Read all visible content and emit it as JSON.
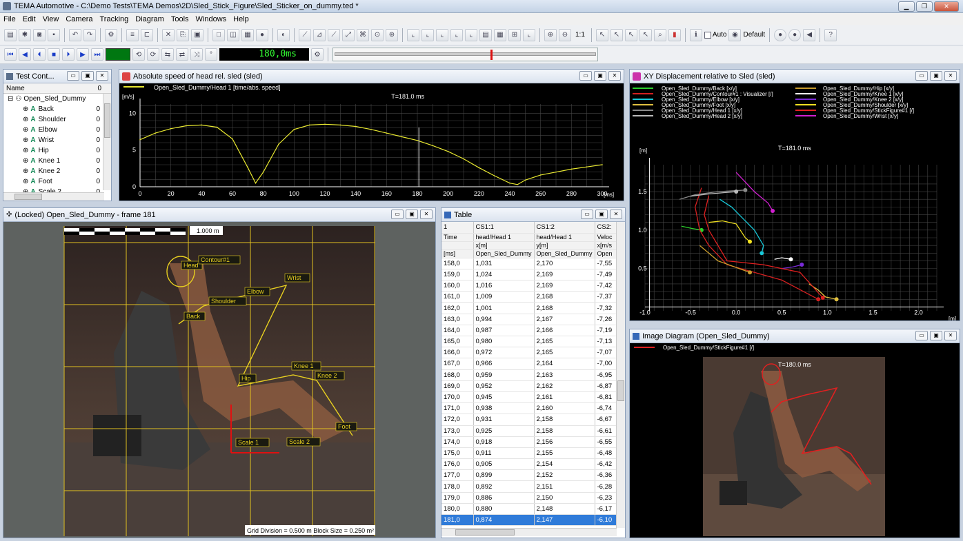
{
  "app": {
    "title": "TEMA Automotive - C:\\Demo Tests\\TEMA Demos\\2D\\Sled_Stick_Figure\\Sled_Sticker_on_dummy.ted *"
  },
  "menu": [
    "File",
    "Edit",
    "View",
    "Camera",
    "Tracking",
    "Diagram",
    "Tools",
    "Windows",
    "Help"
  ],
  "toolbar": {
    "scale_label": "1:1",
    "auto_label": "Auto",
    "default_label": "Default",
    "time_display": "180,0ms"
  },
  "panes": {
    "test_control": {
      "title": "Test Cont...",
      "col_name": "Name",
      "col_val": "0",
      "root": "Open_Sled_Dummy",
      "items": [
        {
          "label": "Back",
          "val": "0"
        },
        {
          "label": "Shoulder",
          "val": "0"
        },
        {
          "label": "Elbow",
          "val": "0"
        },
        {
          "label": "Wrist",
          "val": "0"
        },
        {
          "label": "Hip",
          "val": "0"
        },
        {
          "label": "Knee 1",
          "val": "0"
        },
        {
          "label": "Knee 2",
          "val": "0"
        },
        {
          "label": "Foot",
          "val": "0"
        },
        {
          "label": "Scale 2",
          "val": "0"
        }
      ]
    },
    "speed": {
      "title": "Absolute speed of head rel. sled (sled)",
      "legend": "Open_Sled_Dummy/Head 1 [time/abs. speed]",
      "unit_y": "[m/s]",
      "unit_x": "[ms]",
      "marker": "T=181.0 ms"
    },
    "xy": {
      "title": "XY Displacement relative to Sled (sled)",
      "unit_y": "[m]",
      "unit_x": "[m]",
      "marker": "T=181.0 ms",
      "legend_left": [
        {
          "label": "Open_Sled_Dummy/Back [x/y]",
          "color": "#2bd12b"
        },
        {
          "label": "Open_Sled_Dummy/Contour#1 : Visualizer [/]",
          "color": "#d42020"
        },
        {
          "label": "Open_Sled_Dummy/Elbow [x/y]",
          "color": "#18c8d8"
        },
        {
          "label": "Open_Sled_Dummy/Foot [x/y]",
          "color": "#e0c040"
        },
        {
          "label": "Open_Sled_Dummy/Head 1 [x/y]",
          "color": "#8a8a8a"
        },
        {
          "label": "Open_Sled_Dummy/Head 2 [x/y]",
          "color": "#bbbbbb"
        }
      ],
      "legend_right": [
        {
          "label": "Open_Sled_Dummy/Hip [x/y]",
          "color": "#c89b2b"
        },
        {
          "label": "Open_Sled_Dummy/Knee 1 [x/y]",
          "color": "#ffffff"
        },
        {
          "label": "Open_Sled_Dummy/Knee 2 [x/y]",
          "color": "#7a2bd8"
        },
        {
          "label": "Open_Sled_Dummy/Shoulder [x/y]",
          "color": "#f0e020"
        },
        {
          "label": "Open_Sled_Dummy/StickFigure#1 [/]",
          "color": "#e02020"
        },
        {
          "label": "Open_Sled_Dummy/Wrist [x/y]",
          "color": "#d020d0"
        }
      ]
    },
    "video": {
      "title": "(Locked) Open_Sled_Dummy - frame 181",
      "scale_label": "1.000 m",
      "grid_info": "Grid Division = 0.500 m  Block Size = 0.250 m²",
      "labels": [
        "Head",
        "Contour#1",
        "Wrist",
        "Shoulder",
        "Elbow",
        "Back",
        "Hip",
        "Knee 1",
        "Knee 2",
        "Foot",
        "Scale 1",
        "Scale 2"
      ]
    },
    "table": {
      "title": "Table",
      "cols": [
        "1",
        "CS1:1",
        "CS1:2",
        "CS2:"
      ],
      "hdr": [
        [
          "Time",
          "head/Head 1",
          "head/Head 1",
          "Veloc"
        ],
        [
          "",
          "x[m]",
          "y[m]",
          "x[m/s"
        ],
        [
          "[ms]",
          "Open_Sled_Dummy",
          "Open_Sled_Dummy",
          "Open"
        ]
      ],
      "rows": [
        [
          "158,0",
          "1,031",
          "2,170",
          "-7,55"
        ],
        [
          "159,0",
          "1,024",
          "2,169",
          "-7,49"
        ],
        [
          "160,0",
          "1,016",
          "2,169",
          "-7,42"
        ],
        [
          "161,0",
          "1,009",
          "2,168",
          "-7,37"
        ],
        [
          "162,0",
          "1,001",
          "2,168",
          "-7,32"
        ],
        [
          "163,0",
          "0,994",
          "2,167",
          "-7,26"
        ],
        [
          "164,0",
          "0,987",
          "2,166",
          "-7,19"
        ],
        [
          "165,0",
          "0,980",
          "2,165",
          "-7,13"
        ],
        [
          "166,0",
          "0,972",
          "2,165",
          "-7,07"
        ],
        [
          "167,0",
          "0,966",
          "2,164",
          "-7,00"
        ],
        [
          "168,0",
          "0,959",
          "2,163",
          "-6,95"
        ],
        [
          "169,0",
          "0,952",
          "2,162",
          "-6,87"
        ],
        [
          "170,0",
          "0,945",
          "2,161",
          "-6,81"
        ],
        [
          "171,0",
          "0,938",
          "2,160",
          "-6,74"
        ],
        [
          "172,0",
          "0,931",
          "2,158",
          "-6,67"
        ],
        [
          "173,0",
          "0,925",
          "2,158",
          "-6,61"
        ],
        [
          "174,0",
          "0,918",
          "2,156",
          "-6,55"
        ],
        [
          "175,0",
          "0,911",
          "2,155",
          "-6,48"
        ],
        [
          "176,0",
          "0,905",
          "2,154",
          "-6,42"
        ],
        [
          "177,0",
          "0,899",
          "2,152",
          "-6,36"
        ],
        [
          "178,0",
          "0,892",
          "2,151",
          "-6,28"
        ],
        [
          "179,0",
          "0,886",
          "2,150",
          "-6,23"
        ],
        [
          "180,0",
          "0,880",
          "2,148",
          "-6,17"
        ],
        [
          "181,0",
          "0,874",
          "2,147",
          "-6,10"
        ]
      ],
      "selected_index": 23
    },
    "image": {
      "title": "Image Diagram (Open_Sled_Dummy)",
      "legend": "Open_Sled_Dummy/StickFigure#1 [/]",
      "marker": "T=180.0 ms"
    }
  },
  "chart_data": [
    {
      "type": "line",
      "title": "Absolute speed of head rel. sled (sled)",
      "xlabel": "[ms]",
      "ylabel": "[m/s]",
      "xlim": [
        0,
        300
      ],
      "ylim": [
        0,
        12
      ],
      "x": [
        0,
        10,
        20,
        30,
        40,
        50,
        60,
        70,
        75,
        80,
        90,
        100,
        110,
        120,
        130,
        140,
        150,
        160,
        170,
        180,
        190,
        200,
        210,
        220,
        230,
        240,
        245,
        250,
        260,
        270,
        280,
        290,
        300
      ],
      "series": [
        {
          "name": "Open_Sled_Dummy/Head 1 [time/abs. speed]",
          "values": [
            6.4,
            7.3,
            7.9,
            8.3,
            8.4,
            8.1,
            6.5,
            2.6,
            0.5,
            2.0,
            5.8,
            7.8,
            8.4,
            8.5,
            8.4,
            8.2,
            7.8,
            7.3,
            6.8,
            6.3,
            5.6,
            4.8,
            3.8,
            2.6,
            1.5,
            0.5,
            0.3,
            0.9,
            1.6,
            2.0,
            2.4,
            2.7,
            3.0
          ]
        }
      ],
      "x_ticks": [
        0,
        20,
        40,
        60,
        80,
        100,
        120,
        140,
        160,
        180,
        200,
        220,
        240,
        260,
        280,
        300
      ],
      "y_ticks": [
        0,
        5,
        10
      ],
      "grid": true
    },
    {
      "type": "scatter",
      "title": "XY Displacement relative to Sled (sled)",
      "xlabel": "[m]",
      "ylabel": "[m]",
      "xlim": [
        -1.0,
        2.2
      ],
      "ylim": [
        -0.05,
        1.85
      ],
      "x_ticks": [
        -1.0,
        -0.5,
        0,
        0.5,
        1.0,
        1.5,
        2.0
      ],
      "y_ticks": [
        0.5,
        1.0,
        1.5
      ],
      "grid": true,
      "series": [
        {
          "name": "Open_Sled_Dummy/Back [x/y]",
          "color": "#2bd12b",
          "points": [
            [
              -0.6,
              1.05
            ],
            [
              -0.48,
              1.02
            ],
            [
              -0.38,
              1.0
            ]
          ]
        },
        {
          "name": "Open_Sled_Dummy/Contour#1 : Visualizer [/]",
          "color": "#d42020",
          "points": [
            [
              -0.38,
              1.55
            ],
            [
              -0.45,
              1.3
            ],
            [
              -0.4,
              1.0
            ],
            [
              -0.3,
              0.8
            ],
            [
              -0.1,
              0.55
            ],
            [
              0.2,
              0.45
            ],
            [
              0.5,
              0.35
            ],
            [
              0.9,
              0.1
            ]
          ]
        },
        {
          "name": "Open_Sled_Dummy/Elbow [x/y]",
          "color": "#18c8d8",
          "points": [
            [
              -0.18,
              1.4
            ],
            [
              -0.05,
              1.3
            ],
            [
              0.05,
              1.18
            ],
            [
              0.2,
              1.0
            ],
            [
              0.3,
              0.8
            ],
            [
              0.28,
              0.7
            ]
          ]
        },
        {
          "name": "Open_Sled_Dummy/Foot [x/y]",
          "color": "#e0c040",
          "points": [
            [
              0.8,
              0.3
            ],
            [
              0.9,
              0.22
            ],
            [
              0.98,
              0.13
            ],
            [
              1.1,
              0.1
            ]
          ]
        },
        {
          "name": "Open_Sled_Dummy/Head 1 [x/y]",
          "color": "#8a8a8a",
          "points": [
            [
              -0.62,
              1.4
            ],
            [
              -0.45,
              1.46
            ],
            [
              -0.2,
              1.5
            ],
            [
              0.1,
              1.52
            ]
          ]
        },
        {
          "name": "Open_Sled_Dummy/Head 2 [x/y]",
          "color": "#bbbbbb",
          "points": [
            [
              -0.5,
              1.44
            ],
            [
              -0.3,
              1.47
            ],
            [
              0.0,
              1.5
            ]
          ]
        },
        {
          "name": "Open_Sled_Dummy/Hip [x/y]",
          "color": "#c89b2b",
          "points": [
            [
              -0.4,
              0.8
            ],
            [
              -0.2,
              0.6
            ],
            [
              0.03,
              0.5
            ],
            [
              0.15,
              0.45
            ]
          ]
        },
        {
          "name": "Open_Sled_Dummy/Knee 1 [x/y]",
          "color": "#ffffff",
          "points": [
            [
              0.42,
              0.62
            ],
            [
              0.5,
              0.64
            ],
            [
              0.6,
              0.62
            ]
          ]
        },
        {
          "name": "Open_Sled_Dummy/Knee 2 [x/y]",
          "color": "#7a2bd8",
          "points": [
            [
              0.5,
              0.5
            ],
            [
              0.62,
              0.52
            ],
            [
              0.72,
              0.55
            ]
          ]
        },
        {
          "name": "Open_Sled_Dummy/Shoulder [x/y]",
          "color": "#f0e020",
          "points": [
            [
              -0.3,
              1.1
            ],
            [
              -0.15,
              1.12
            ],
            [
              0.0,
              1.08
            ],
            [
              0.1,
              0.9
            ],
            [
              0.15,
              0.85
            ]
          ]
        },
        {
          "name": "Open_Sled_Dummy/StickFigure#1 [/]",
          "color": "#e02020",
          "points": [
            [
              -0.3,
              1.45
            ],
            [
              -0.35,
              1.2
            ],
            [
              -0.3,
              1.0
            ],
            [
              -0.1,
              0.6
            ],
            [
              0.3,
              0.55
            ],
            [
              0.7,
              0.45
            ],
            [
              0.95,
              0.12
            ]
          ]
        },
        {
          "name": "Open_Sled_Dummy/Wrist [x/y]",
          "color": "#d020d0",
          "points": [
            [
              0.0,
              1.75
            ],
            [
              0.2,
              1.5
            ],
            [
              0.35,
              1.35
            ],
            [
              0.4,
              1.25
            ]
          ]
        }
      ]
    }
  ]
}
